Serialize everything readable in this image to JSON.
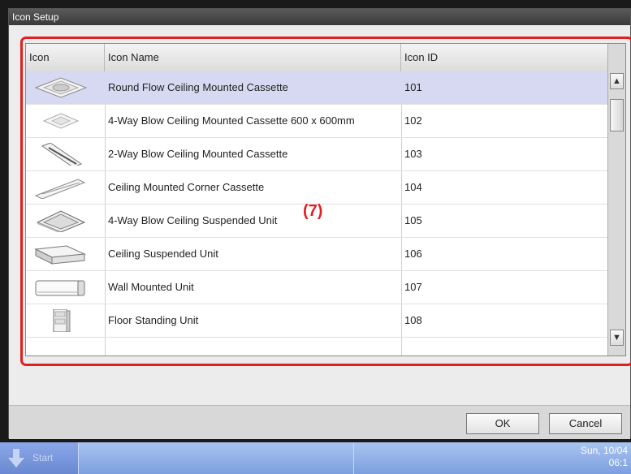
{
  "window": {
    "title": "Icon Setup"
  },
  "table": {
    "columns": {
      "icon": "Icon",
      "name": "Icon Name",
      "id": "Icon ID"
    },
    "rows": [
      {
        "icon": "round-flow-cassette-icon",
        "name": "Round Flow Ceiling Mounted Cassette",
        "id": "101",
        "selected": true
      },
      {
        "icon": "four-way-cassette-600-icon",
        "name": "4-Way Blow Ceiling Mounted Cassette 600 x 600mm",
        "id": "102",
        "selected": false
      },
      {
        "icon": "two-way-cassette-icon",
        "name": "2-Way Blow Ceiling Mounted Cassette",
        "id": "103",
        "selected": false
      },
      {
        "icon": "corner-cassette-icon",
        "name": "Ceiling Mounted Corner Cassette",
        "id": "104",
        "selected": false
      },
      {
        "icon": "four-way-suspended-icon",
        "name": "4-Way Blow Ceiling Suspended Unit",
        "id": "105",
        "selected": false
      },
      {
        "icon": "ceiling-suspended-icon",
        "name": "Ceiling Suspended Unit",
        "id": "106",
        "selected": false
      },
      {
        "icon": "wall-mounted-icon",
        "name": "Wall Mounted Unit",
        "id": "107",
        "selected": false
      },
      {
        "icon": "floor-standing-icon",
        "name": "Floor Standing Unit",
        "id": "108",
        "selected": false
      }
    ]
  },
  "annotation": {
    "label": "(7)",
    "color": "#e02020"
  },
  "buttons": {
    "ok": "OK",
    "cancel": "Cancel"
  },
  "taskbar": {
    "start_label": "Start",
    "clock_line1": "Sun, 10/04",
    "clock_line2": "06:1"
  },
  "colors": {
    "selected_row": "#d7d9f2",
    "taskbar": "#8fb0ea"
  }
}
